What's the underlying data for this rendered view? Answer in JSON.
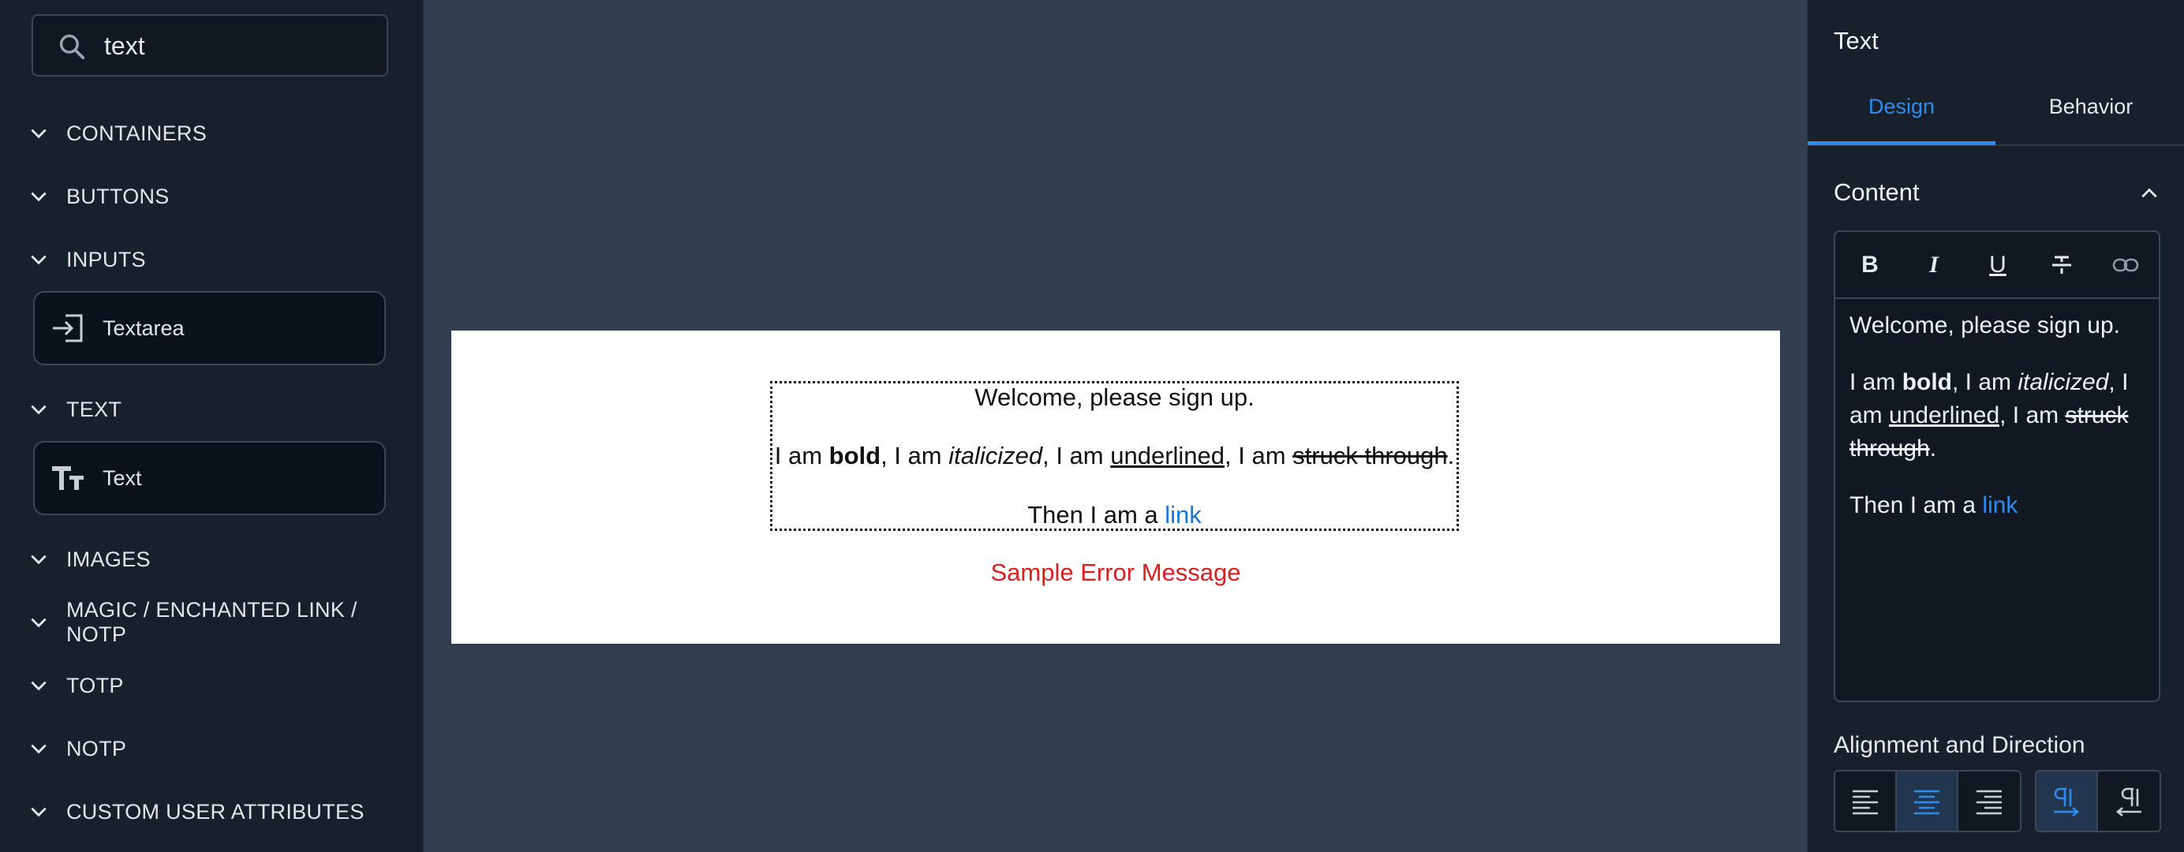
{
  "sidebar": {
    "search": {
      "value": "text",
      "icon": "search-icon"
    },
    "categories": [
      {
        "label": "CONTAINERS"
      },
      {
        "label": "BUTTONS"
      },
      {
        "label": "INPUTS"
      },
      {
        "label": "TEXT"
      },
      {
        "label": "IMAGES"
      },
      {
        "label": "MAGIC / ENCHANTED LINK / NOTP"
      },
      {
        "label": "TOTP"
      },
      {
        "label": "NOTP"
      },
      {
        "label": "CUSTOM USER ATTRIBUTES"
      }
    ],
    "components": {
      "textarea": {
        "label": "Textarea",
        "icon": "input-arrow-icon"
      },
      "text": {
        "label": "Text",
        "icon": "text-size-icon"
      }
    }
  },
  "canvas": {
    "line1": "Welcome, please sign up.",
    "line2": {
      "p1": "I am ",
      "bold": "bold",
      "p2": ", I am ",
      "italic": "italicized",
      "p3": ", I am ",
      "underline": "underlined",
      "p4": ", I am ",
      "strike": "struck through",
      "p5": "."
    },
    "line3": {
      "text": "Then I am a ",
      "link": "link"
    },
    "error": "Sample Error Message"
  },
  "panel": {
    "title": "Text",
    "tabs": [
      {
        "label": "Design",
        "active": true
      },
      {
        "label": "Behavior",
        "active": false
      }
    ],
    "section": "Content",
    "editor": {
      "toolbar": [
        "bold-icon",
        "italic-icon",
        "underline-icon",
        "strikethrough-icon",
        "link-icon"
      ],
      "para1": "Welcome, please sign up.",
      "para2": {
        "p1": "I am ",
        "bold": "bold",
        "p2": ", I am ",
        "italic": "italicized",
        "p3": ", I am ",
        "underline": "underlined,",
        "p4": " I am ",
        "strike": "struck through",
        "p5": "."
      },
      "para3": {
        "text": "Then I am a ",
        "link": "link"
      }
    },
    "alignment_title": "Alignment and Direction",
    "alignment": {
      "selected": "center",
      "direction_selected": "ltr"
    }
  },
  "colors": {
    "accent": "#2e8cf0",
    "error": "#d82020",
    "link": "#1677d8",
    "sidebar_bg": "#18202b",
    "canvas_bg": "#323d50"
  }
}
